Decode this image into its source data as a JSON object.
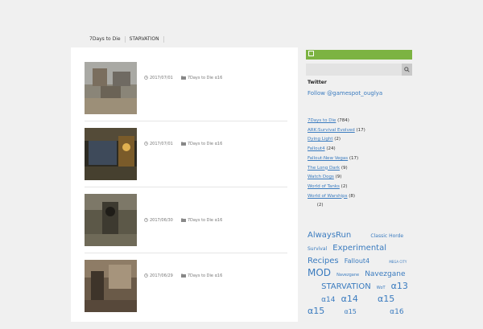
{
  "site": {
    "title": "",
    "description": ""
  },
  "nav": {
    "items": [
      {
        "label": ""
      },
      {
        "label": "7Days to Die"
      },
      {
        "label": "STARVATION"
      },
      {
        "label": ""
      },
      {
        "label": ""
      }
    ]
  },
  "posts": [
    {
      "title": "",
      "date": "2017/07/01",
      "category": "7Days to Die α16",
      "excerpt": ""
    },
    {
      "title": "",
      "date": "2017/07/01",
      "category": "7Days to Die α16",
      "excerpt": ""
    },
    {
      "title": "",
      "date": "2017/06/30",
      "category": "7Days to Die α16",
      "excerpt": ""
    },
    {
      "title": "",
      "date": "2017/06/29",
      "category": "7Days to Die α16",
      "excerpt": ""
    }
  ],
  "sidebar": {
    "search_heading": "",
    "search_placeholder": "",
    "twitter_heading": "Twitter",
    "twitter_link": "Follow @gamespot_ouglya",
    "categories_heading": "",
    "categories": [
      {
        "name": "7Days to Die",
        "count": "(784)"
      },
      {
        "name": "ARK:Survival Evolved",
        "count": "(17)"
      },
      {
        "name": "Dying Light",
        "count": "(2)"
      },
      {
        "name": "Fallout4",
        "count": "(24)"
      },
      {
        "name": "Fallout:New Vegas",
        "count": "(17)"
      },
      {
        "name": "The Long Dark",
        "count": "(9)"
      },
      {
        "name": "Watch Dogs",
        "count": "(9)"
      },
      {
        "name": "World of Tanks",
        "count": "(2)"
      },
      {
        "name": "World of Warships",
        "count": "(8)"
      },
      {
        "name": "",
        "count": "(2)"
      }
    ],
    "tags_heading": "",
    "tags": [
      {
        "label": "AlwaysRun",
        "size": 10
      },
      {
        "label": "",
        "size": 10
      },
      {
        "label": "Classic Horde",
        "size": 6
      },
      {
        "label": "Survival",
        "size": 6
      },
      {
        "label": "Experimental",
        "size": 10
      },
      {
        "label": "Recipes",
        "size": 10
      },
      {
        "label": "Fallout4",
        "size": 8
      },
      {
        "label": "",
        "size": 8
      },
      {
        "label": "MEGA CITY",
        "size": 4
      },
      {
        "label": "MOD",
        "size": 12
      },
      {
        "label": "Navezgane",
        "size": 5
      },
      {
        "label": "Navezgane",
        "size": 9
      },
      {
        "label": "",
        "size": 9
      },
      {
        "label": "STARVATION",
        "size": 10
      },
      {
        "label": "WoT",
        "size": 5
      },
      {
        "label": "α13",
        "size": 11
      },
      {
        "label": "",
        "size": 11
      },
      {
        "label": "α14",
        "size": 9
      },
      {
        "label": "α14",
        "size": 11
      },
      {
        "label": "",
        "size": 11
      },
      {
        "label": "α15",
        "size": 11
      },
      {
        "label": "α15",
        "size": 11
      },
      {
        "label": "",
        "size": 11
      },
      {
        "label": "α15",
        "size": 8
      },
      {
        "label": "",
        "size": 8
      },
      {
        "label": "",
        "size": 9
      },
      {
        "label": "α16",
        "size": 9
      },
      {
        "label": "",
        "size": 6
      },
      {
        "label": "",
        "size": 9
      },
      {
        "label": "",
        "size": 7
      }
    ]
  },
  "colors": {
    "accent_green": "#7cb342",
    "link_blue": "#3a7bbf"
  },
  "icons": {
    "clock": "clock-icon",
    "folder": "folder-icon",
    "search": "search-icon"
  }
}
